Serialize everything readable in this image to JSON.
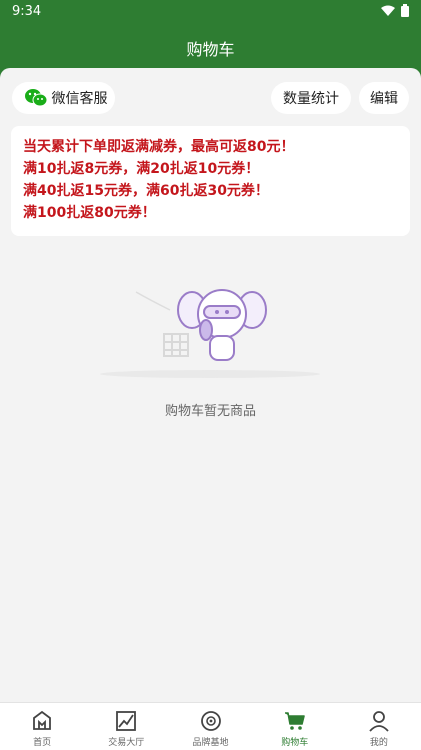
{
  "status_bar": {
    "time": "9:34"
  },
  "header": {
    "title": "购物车"
  },
  "toolbar": {
    "wechat_service_label": "微信客服",
    "quantity_stats_label": "数量统计",
    "edit_label": "编辑"
  },
  "promo": {
    "lines": [
      "当天累计下单即返满减券，最高可返80元！",
      "满10扎返8元券，满20扎返10元券！",
      "满40扎返15元券，满60扎返30元券！",
      "满100扎返80元券！"
    ]
  },
  "empty_state": {
    "message": "购物车暂无商品"
  },
  "tabbar": {
    "items": [
      {
        "label": "首页",
        "icon": "home-icon"
      },
      {
        "label": "交易大厅",
        "icon": "trading-chart-icon"
      },
      {
        "label": "品牌基地",
        "icon": "brand-badge-icon"
      },
      {
        "label": "购物车",
        "icon": "cart-icon"
      },
      {
        "label": "我的",
        "icon": "profile-icon"
      }
    ],
    "active_index": 3
  },
  "colors": {
    "brand_green": "#2e7d32",
    "promo_red": "#c4161c",
    "wechat_green": "#1aad19",
    "page_bg": "#f3f3f3"
  }
}
